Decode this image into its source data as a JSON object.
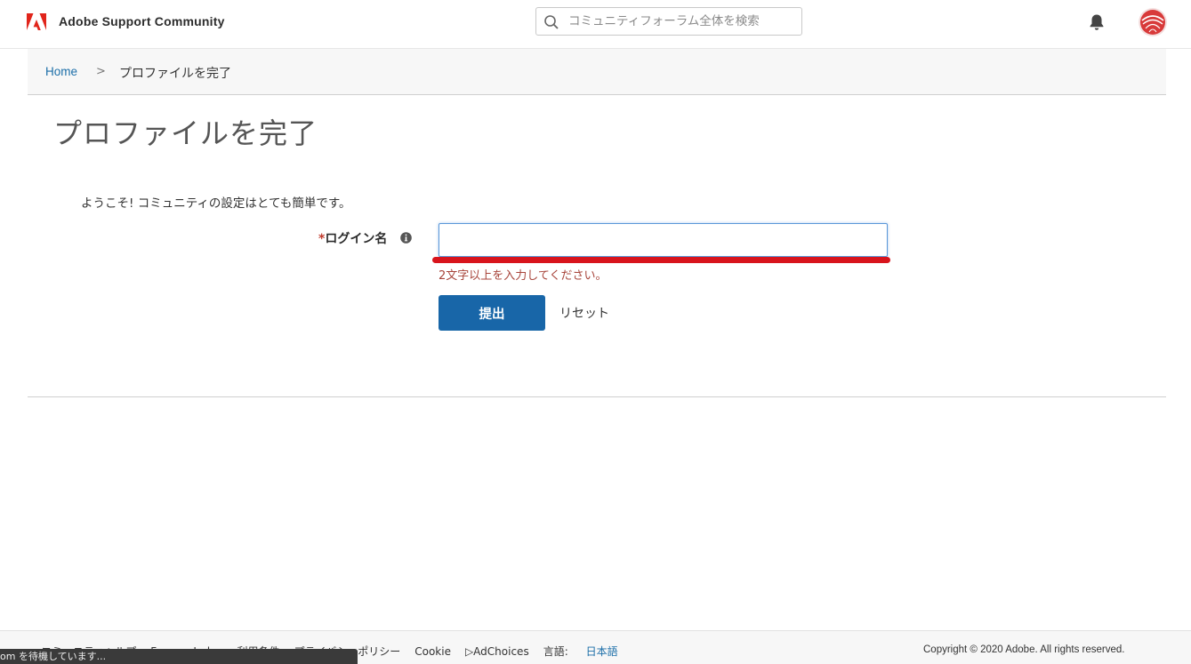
{
  "header": {
    "brand_name": "Adobe Support Community",
    "search_placeholder": "コミュニティフォーラム全体を検索",
    "brand_color": "#e1251b"
  },
  "breadcrumb": {
    "home": "Home",
    "separator": ">",
    "current": "プロファイルを完了"
  },
  "page": {
    "title": "プロファイルを完了",
    "welcome": "ようこそ! コミュニティの設定はとても簡単です。",
    "login_label_required": "*",
    "login_label": "ログイン名",
    "login_value": "",
    "error": "2文字以上を入力してください。",
    "submit_label": "提出",
    "reset_label": "リセット"
  },
  "footer": {
    "links": [
      "コミュニティヘルプ",
      "Forums Index",
      "利用条件",
      "プライバシーポリシー",
      "Cookie",
      "▷AdChoices"
    ],
    "language_label": "言語: ",
    "language_value": "日本語",
    "copyright": "Copyright © 2020 Adobe. All rights reserved."
  },
  "status": {
    "text": "om を待機しています..."
  },
  "colors": {
    "accent_blue": "#1866a8",
    "link_blue": "#1b6ea8",
    "error_red": "#a8453b",
    "annotation_red": "#d8141c"
  }
}
